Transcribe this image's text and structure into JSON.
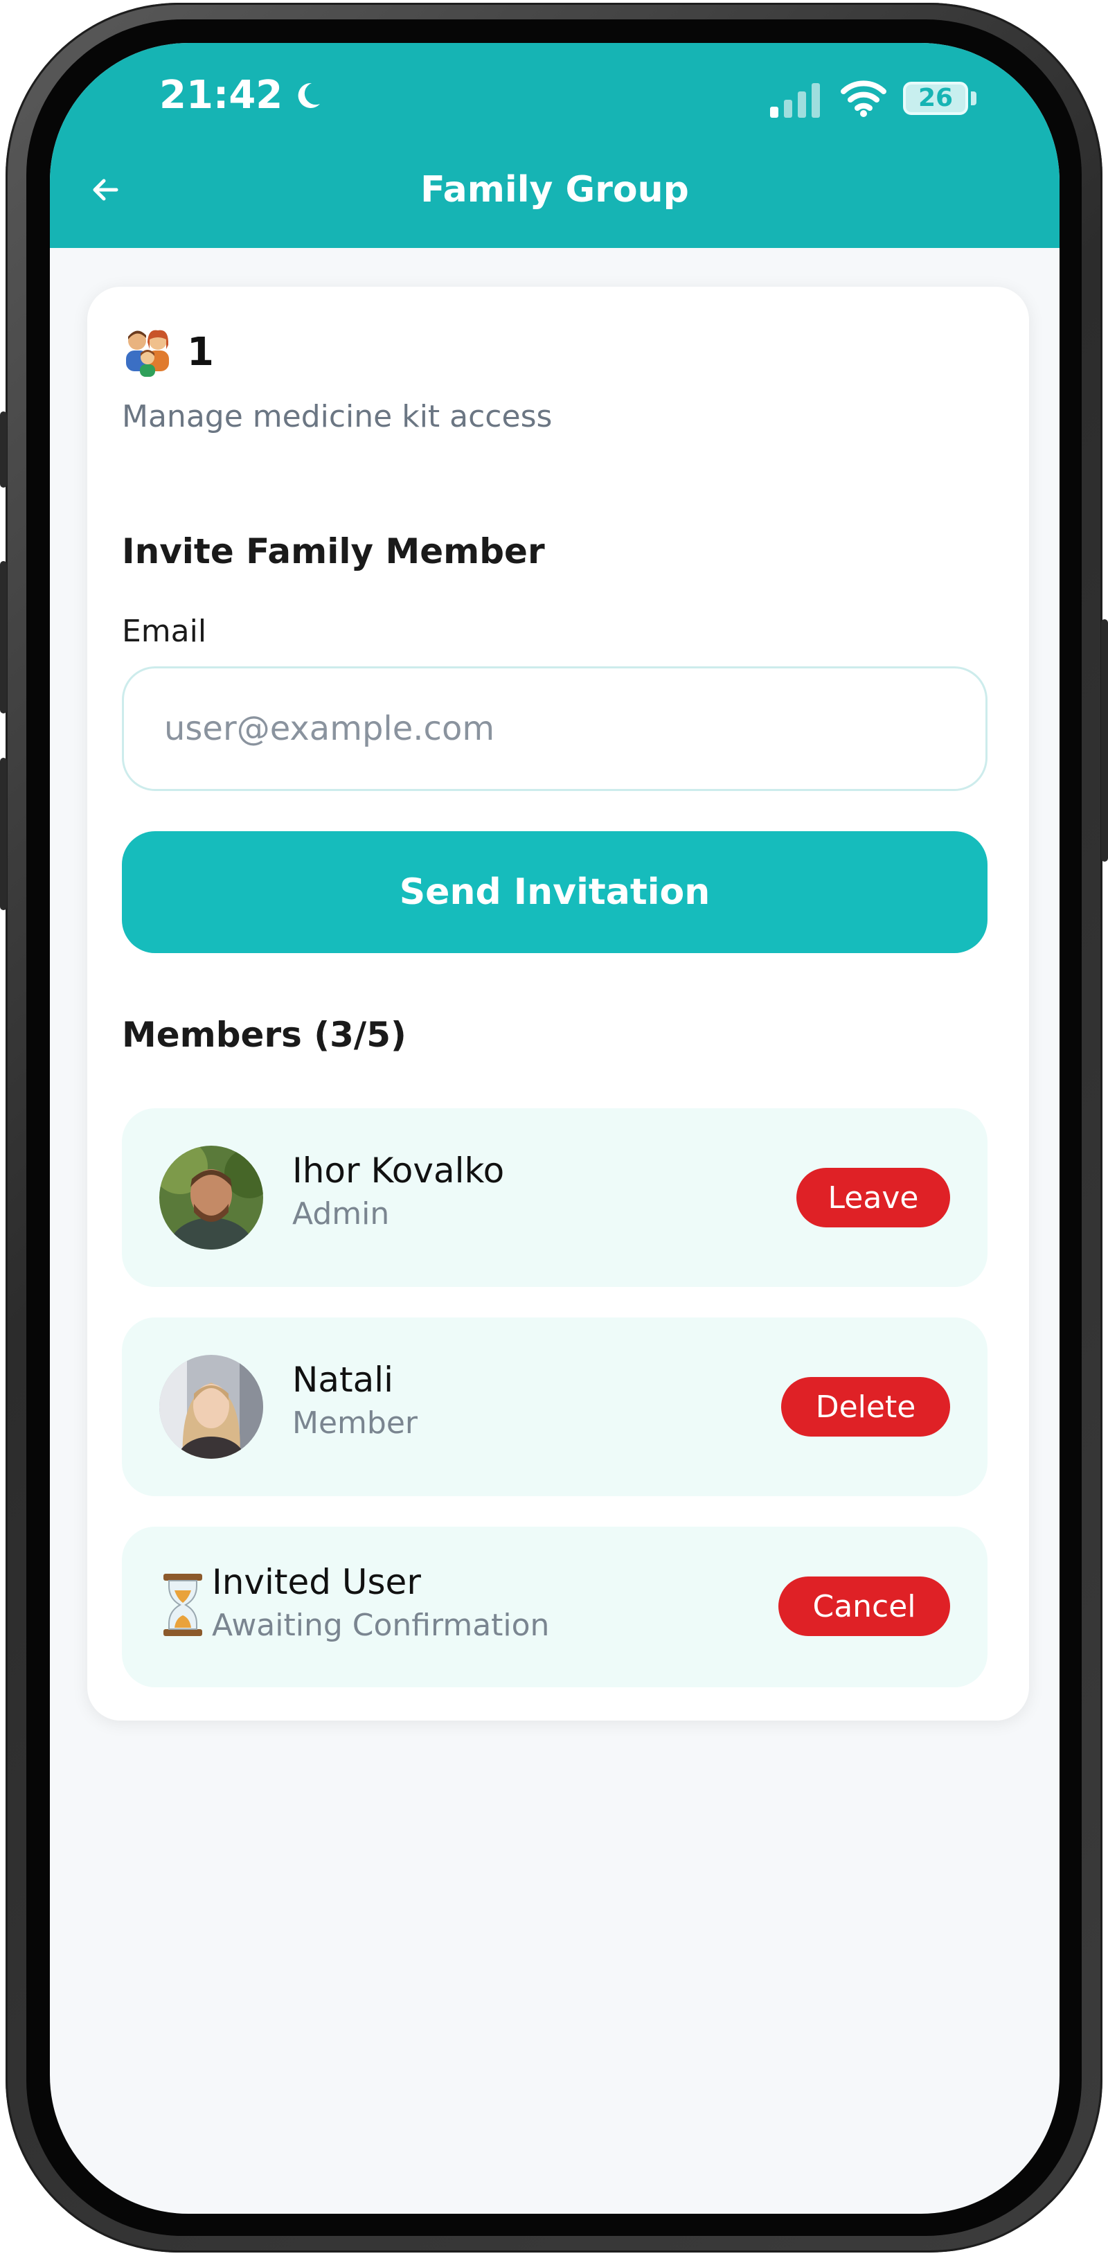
{
  "status_bar": {
    "time": "21:42",
    "battery": "26",
    "icons": [
      "moon-icon",
      "signal-icon",
      "wifi-icon",
      "battery-icon"
    ]
  },
  "header": {
    "title": "Family Group",
    "back_icon": "arrow-left-icon"
  },
  "group": {
    "icon": "family-icon",
    "count": "1",
    "subtitle": "Manage medicine kit access"
  },
  "invite": {
    "title": "Invite Family Member",
    "email_label": "Email",
    "email_value": "",
    "email_placeholder": "user@example.com",
    "send_label": "Send Invitation"
  },
  "members": {
    "title": "Members (3/5)",
    "items": [
      {
        "name": "Ihor Kovalko",
        "role": "Admin",
        "action": "Leave",
        "avatar": "avatar-photo"
      },
      {
        "name": "Natali",
        "role": "Member",
        "action": "Delete",
        "avatar": "avatar-photo"
      },
      {
        "name": "Invited User",
        "role": "Awaiting Confirmation",
        "action": "Cancel",
        "avatar": "hourglass-icon"
      }
    ]
  },
  "colors": {
    "primary": "#16b4b4",
    "danger": "#df2126",
    "member_bg": "#eefbf9",
    "background": "#f6f8fa"
  }
}
